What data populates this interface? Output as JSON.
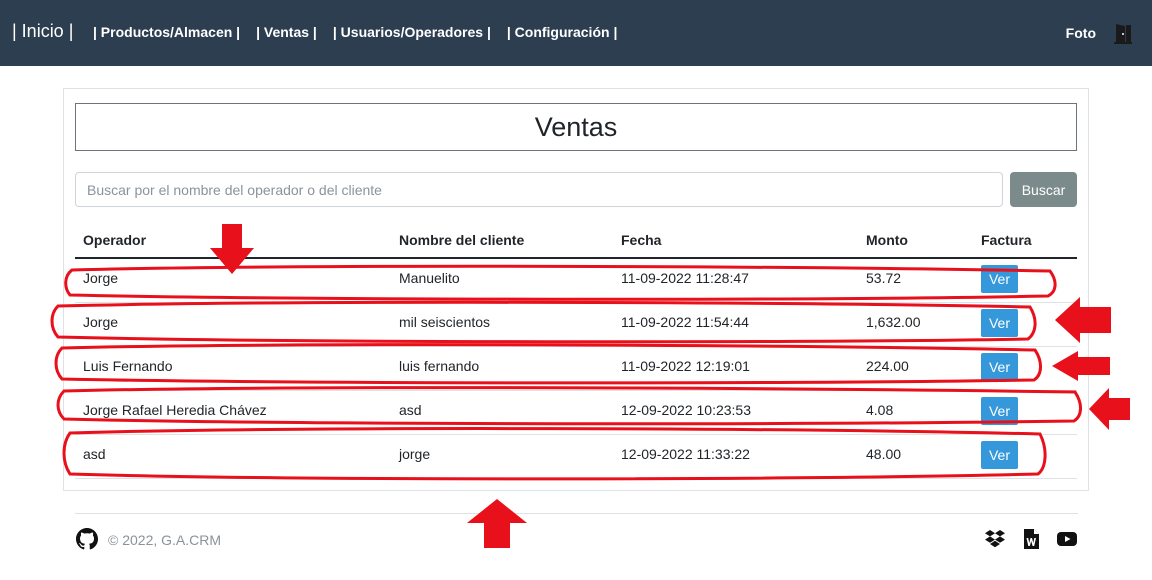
{
  "navbar": {
    "brand": "| Inicio |",
    "links": [
      "| Productos/Almacen |",
      "| Ventas |",
      "| Usuarios/Operadores |",
      "| Configuración |"
    ],
    "foto": "Foto"
  },
  "page": {
    "title": "Ventas",
    "search_placeholder": "Buscar por el nombre del operador o del cliente",
    "search_button": "Buscar"
  },
  "table": {
    "headers": [
      "Operador",
      "Nombre del cliente",
      "Fecha",
      "Monto",
      "Factura"
    ],
    "rows": [
      {
        "operador": "Jorge",
        "cliente": "Manuelito",
        "fecha": "11-09-2022 11:28:47",
        "monto": "53.72",
        "factura": "Ver"
      },
      {
        "operador": "Jorge",
        "cliente": "mil seiscientos",
        "fecha": "11-09-2022 11:54:44",
        "monto": "1,632.00",
        "factura": "Ver"
      },
      {
        "operador": "Luis Fernando",
        "cliente": "luis fernando",
        "fecha": "11-09-2022 12:19:01",
        "monto": "224.00",
        "factura": "Ver"
      },
      {
        "operador": "Jorge Rafael Heredia Chávez",
        "cliente": "asd",
        "fecha": "12-09-2022 10:23:53",
        "monto": "4.08",
        "factura": "Ver"
      },
      {
        "operador": "asd",
        "cliente": "jorge",
        "fecha": "12-09-2022 11:33:22",
        "monto": "48.00",
        "factura": "Ver"
      }
    ]
  },
  "footer": {
    "copyright": "© 2022, G.A.CRM"
  },
  "colors": {
    "navbar": "#2c3e50",
    "ver_button": "#3498db",
    "search_button": "#7b8a8b",
    "annotation": "#e8101a"
  },
  "icons": [
    "door-icon",
    "github-icon",
    "dropbox-icon",
    "word-file-icon",
    "youtube-icon"
  ]
}
